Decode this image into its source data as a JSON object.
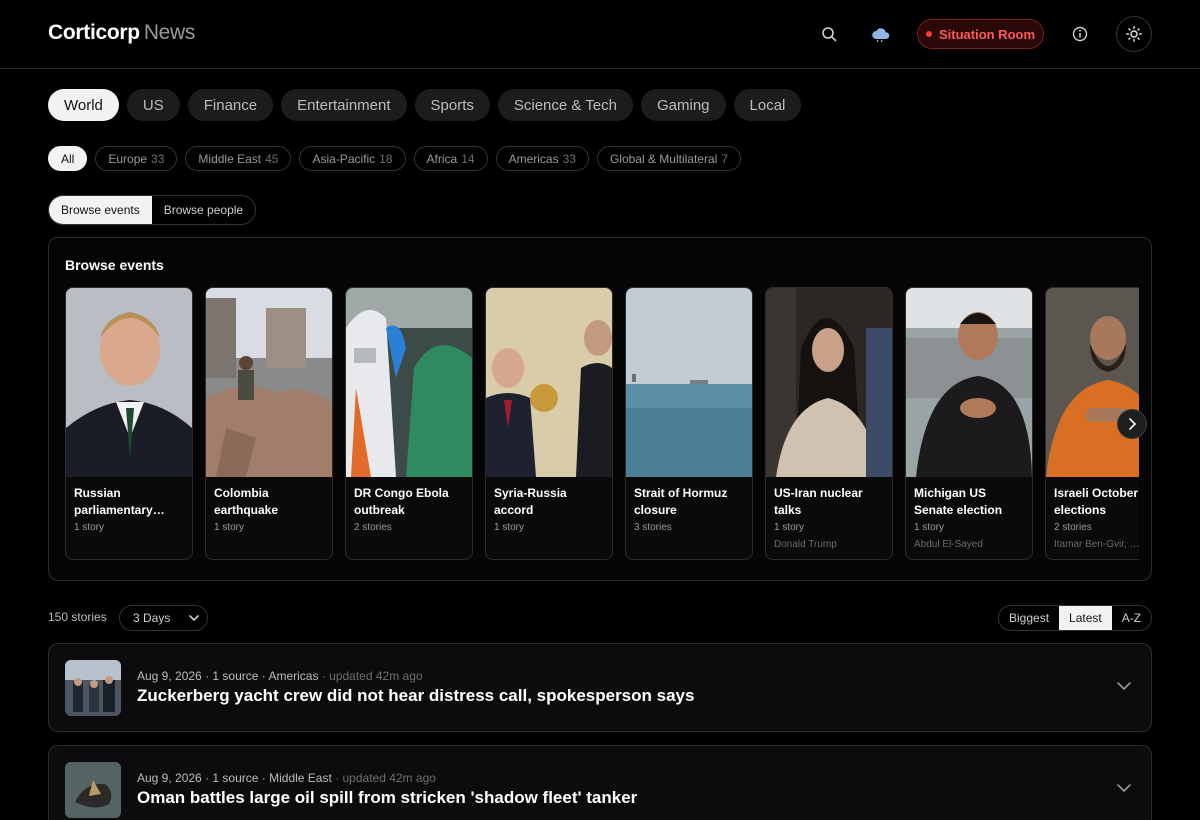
{
  "header": {
    "brand_main": "Corticorp",
    "brand_sub": "News",
    "situation_room": "Situation Room",
    "icons": [
      "search-icon",
      "cloud-icon",
      "info-icon",
      "sun-icon"
    ]
  },
  "categories": [
    {
      "label": "World",
      "active": true
    },
    {
      "label": "US"
    },
    {
      "label": "Finance"
    },
    {
      "label": "Entertainment"
    },
    {
      "label": "Sports"
    },
    {
      "label": "Science & Tech"
    },
    {
      "label": "Gaming"
    },
    {
      "label": "Local"
    }
  ],
  "regions": [
    {
      "label": "All",
      "count": "",
      "active": true
    },
    {
      "label": "Europe",
      "count": "33"
    },
    {
      "label": "Middle East",
      "count": "45"
    },
    {
      "label": "Asia-Pacific",
      "count": "18"
    },
    {
      "label": "Africa",
      "count": "14"
    },
    {
      "label": "Americas",
      "count": "33"
    },
    {
      "label": "Global & Multilateral",
      "count": "7"
    }
  ],
  "browse_toggle": {
    "events": "Browse events",
    "people": "Browse people"
  },
  "events_panel": {
    "title": "Browse events",
    "cards": [
      {
        "title": "Russian parliamentary…",
        "count": "1 story",
        "person": ""
      },
      {
        "title": "Colombia earthquake",
        "count": "1 story",
        "person": ""
      },
      {
        "title": "DR Congo Ebola outbreak",
        "count": "2 stories",
        "person": ""
      },
      {
        "title": "Syria-Russia accord",
        "count": "1 story",
        "person": ""
      },
      {
        "title": "Strait of Hormuz closure",
        "count": "3 stories",
        "person": ""
      },
      {
        "title": "US-Iran nuclear talks",
        "count": "1 story",
        "person": "Donald Trump"
      },
      {
        "title": "Michigan US Senate election",
        "count": "1 story",
        "person": "Abdul El-Sayed"
      },
      {
        "title": "Israeli October elections",
        "count": "2 stories",
        "person": "Itamar Ben-Gvir, …"
      }
    ]
  },
  "stories_bar": {
    "count": "150 stories",
    "range": "3 Days",
    "sort": [
      "Biggest",
      "Latest",
      "A-Z"
    ],
    "sort_active": "Latest"
  },
  "stories": [
    {
      "date": "Aug 9, 2026",
      "sources": "1 source",
      "region": "Americas",
      "updated": "updated 42m ago",
      "headline": "Zuckerberg yacht crew did not hear distress call, spokesperson says"
    },
    {
      "date": "Aug 9, 2026",
      "sources": "1 source",
      "region": "Middle East",
      "updated": "updated 42m ago",
      "headline": "Oman battles large oil spill from stricken 'shadow fleet' tanker"
    }
  ],
  "colors": {
    "accent_red": "#ff3b3b",
    "bg": "#000000",
    "surface": "#0c0c0e"
  }
}
